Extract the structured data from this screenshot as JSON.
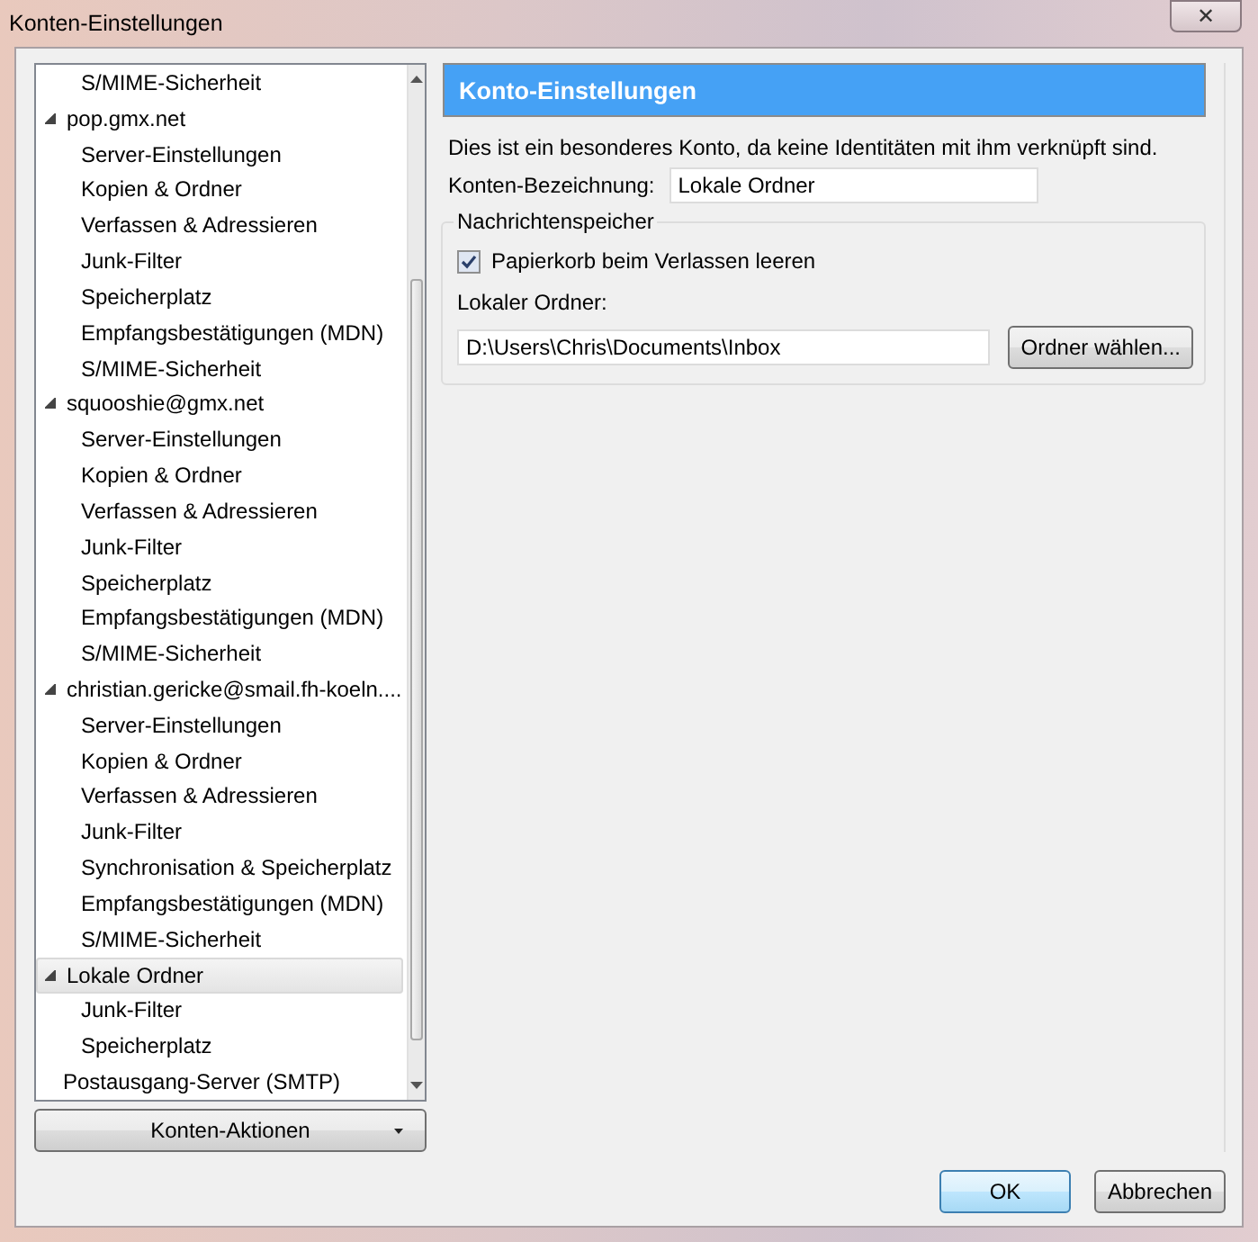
{
  "window": {
    "title": "Konten-Einstellungen",
    "close": "✕"
  },
  "tree": [
    {
      "children": [
        {
          "label": "S/MIME-Sicherheit",
          "selected": false
        }
      ]
    },
    {
      "label": "pop.gmx.net",
      "expanded": true,
      "selected": false,
      "children": [
        {
          "label": "Server-Einstellungen",
          "selected": false
        },
        {
          "label": "Kopien & Ordner",
          "selected": false
        },
        {
          "label": "Verfassen & Adressieren",
          "selected": false
        },
        {
          "label": "Junk-Filter",
          "selected": false
        },
        {
          "label": "Speicherplatz",
          "selected": false
        },
        {
          "label": "Empfangsbestätigungen (MDN)",
          "selected": false
        },
        {
          "label": "S/MIME-Sicherheit",
          "selected": false
        }
      ]
    },
    {
      "label": "squooshie@gmx.net",
      "expanded": true,
      "selected": false,
      "children": [
        {
          "label": "Server-Einstellungen",
          "selected": false
        },
        {
          "label": "Kopien & Ordner",
          "selected": false
        },
        {
          "label": "Verfassen & Adressieren",
          "selected": false
        },
        {
          "label": "Junk-Filter",
          "selected": false
        },
        {
          "label": "Speicherplatz",
          "selected": false
        },
        {
          "label": "Empfangsbestätigungen (MDN)",
          "selected": false
        },
        {
          "label": "S/MIME-Sicherheit",
          "selected": false
        }
      ]
    },
    {
      "label": "christian.gericke@smail.fh-koeln....",
      "expanded": true,
      "selected": false,
      "children": [
        {
          "label": "Server-Einstellungen",
          "selected": false
        },
        {
          "label": "Kopien & Ordner",
          "selected": false
        },
        {
          "label": "Verfassen & Adressieren",
          "selected": false
        },
        {
          "label": "Junk-Filter",
          "selected": false
        },
        {
          "label": "Synchronisation & Speicherplatz",
          "selected": false
        },
        {
          "label": "Empfangsbestätigungen (MDN)",
          "selected": false
        },
        {
          "label": "S/MIME-Sicherheit",
          "selected": false
        }
      ]
    },
    {
      "label": "Lokale Ordner",
      "expanded": true,
      "selected": true,
      "children": [
        {
          "label": "Junk-Filter",
          "selected": false
        },
        {
          "label": "Speicherplatz",
          "selected": false
        }
      ]
    },
    {
      "label": "Postausgang-Server (SMTP)",
      "selected": false
    }
  ],
  "account_actions": {
    "label": "Konten-Aktionen"
  },
  "panel": {
    "header": "Konto-Einstellungen",
    "description": "Dies ist ein besonderes Konto, da keine Identitäten mit ihm verknüpft sind.",
    "name_label": "Konten-Bezeichnung:",
    "name_value": "Lokale Ordner",
    "group": {
      "legend": "Nachrichtenspeicher",
      "checkbox": {
        "label": "Papierkorb beim Verlassen leeren",
        "checked": true
      },
      "folder_label": "Lokaler Ordner:",
      "folder_value": "D:\\Users\\Chris\\Documents\\Inbox",
      "browse": "Ordner wählen..."
    }
  },
  "buttons": [
    "OK",
    "Abbrechen"
  ]
}
